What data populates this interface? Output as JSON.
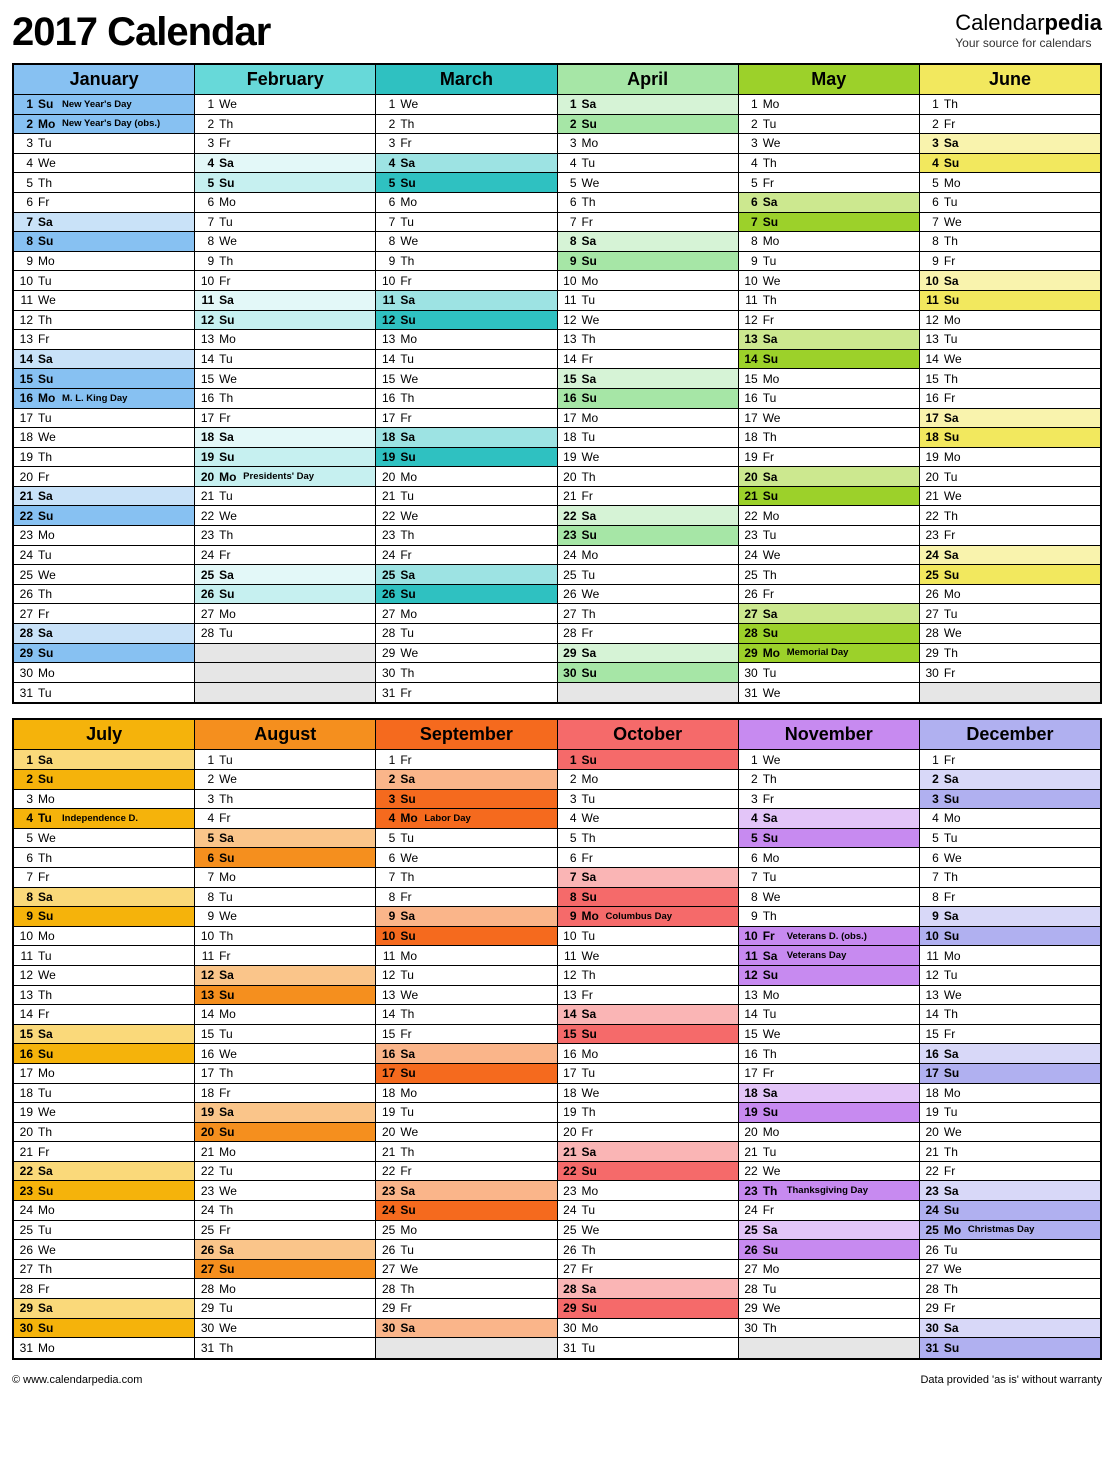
{
  "title": "2017 Calendar",
  "brand": {
    "name1": "Calendar",
    "name2": "pedia",
    "tag": "Your source for calendars"
  },
  "footer": {
    "left": "© www.calendarpedia.com",
    "right": "Data provided 'as is' without warranty"
  },
  "dows": [
    "Su",
    "Mo",
    "Tu",
    "We",
    "Th",
    "Fr",
    "Sa"
  ],
  "months": [
    {
      "name": "January",
      "start": 0,
      "len": 31,
      "head": "#87c1f2",
      "hl": "#87c1f2",
      "lt": "#c9e2f8",
      "events": {
        "1": "New Year's Day",
        "2": "New Year's Day (obs.)",
        "16": "M. L. King Day"
      }
    },
    {
      "name": "February",
      "start": 3,
      "len": 28,
      "head": "#67d9d9",
      "hl": "#c6f0f0",
      "lt": "#e3f8f8",
      "events": {
        "20": "Presidents' Day"
      }
    },
    {
      "name": "March",
      "start": 3,
      "len": 31,
      "head": "#2fc1c1",
      "hl": "#2fc1c1",
      "lt": "#9de3e3",
      "events": {}
    },
    {
      "name": "April",
      "start": 6,
      "len": 30,
      "head": "#a6e6a6",
      "hl": "#a6e6a6",
      "lt": "#d6f3d6",
      "events": {}
    },
    {
      "name": "May",
      "start": 1,
      "len": 31,
      "head": "#9cd12a",
      "hl": "#9cd12a",
      "lt": "#cce88f",
      "events": {
        "29": "Memorial Day"
      }
    },
    {
      "name": "June",
      "start": 4,
      "len": 30,
      "head": "#f2e85e",
      "hl": "#f2e85e",
      "lt": "#f9f3ad",
      "events": {}
    },
    {
      "name": "July",
      "start": 6,
      "len": 31,
      "head": "#f5b30b",
      "hl": "#f5b30b",
      "lt": "#fad97a",
      "events": {
        "4": "Independence D."
      }
    },
    {
      "name": "August",
      "start": 2,
      "len": 31,
      "head": "#f58f1e",
      "hl": "#f58f1e",
      "lt": "#fac58a",
      "events": {}
    },
    {
      "name": "September",
      "start": 5,
      "len": 30,
      "head": "#f56a1e",
      "hl": "#f56a1e",
      "lt": "#fab58a",
      "events": {
        "4": "Labor Day"
      }
    },
    {
      "name": "October",
      "start": 0,
      "len": 31,
      "head": "#f56a6a",
      "hl": "#f56a6a",
      "lt": "#fab5b5",
      "events": {
        "9": "Columbus Day"
      }
    },
    {
      "name": "November",
      "start": 3,
      "len": 30,
      "head": "#c78af0",
      "hl": "#c78af0",
      "lt": "#e3c5f8",
      "events": {
        "10": "Veterans D. (obs.)",
        "11": "Veterans Day",
        "23": "Thanksgiving Day"
      }
    },
    {
      "name": "December",
      "start": 5,
      "len": 31,
      "head": "#b0b0f0",
      "hl": "#b0b0f0",
      "lt": "#d8d8f8",
      "events": {
        "25": "Christmas Day"
      }
    }
  ]
}
